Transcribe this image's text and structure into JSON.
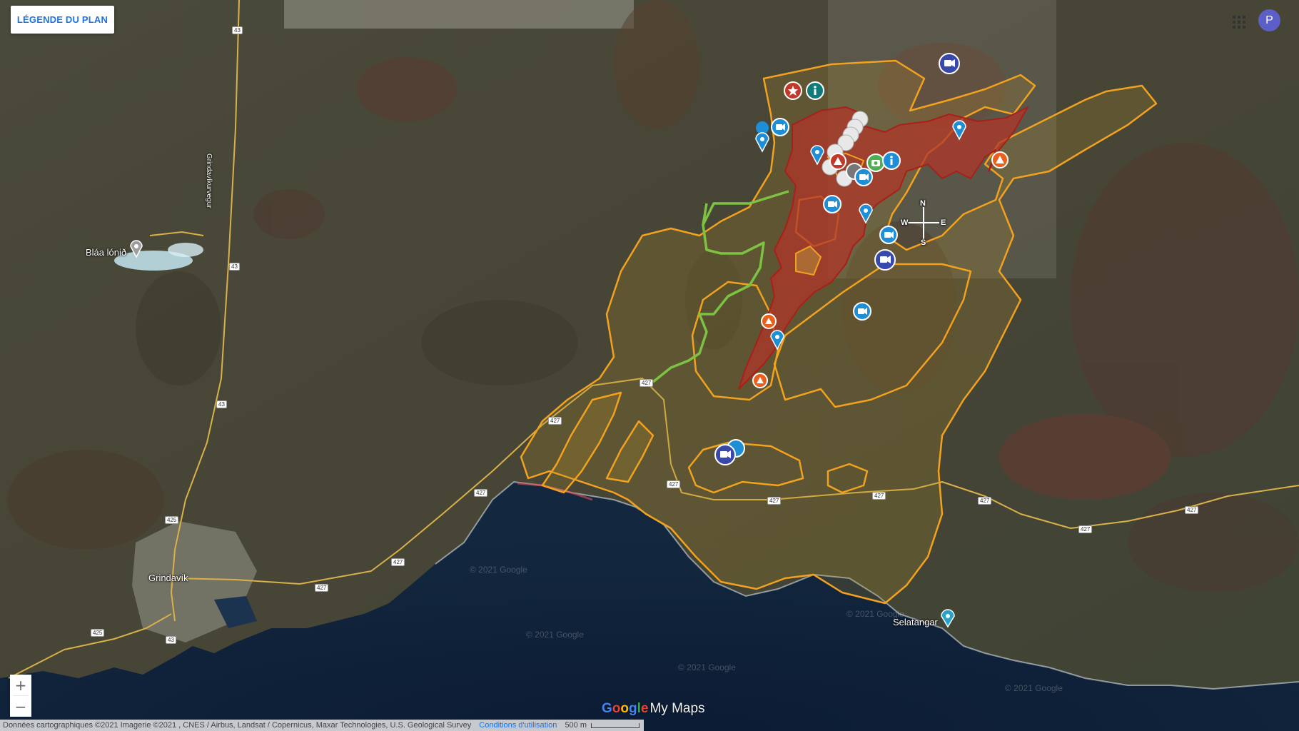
{
  "ui": {
    "legend_button": "LÉGENDE DU PLAN",
    "account_initial": "P",
    "zoom_in": "+",
    "zoom_out": "−"
  },
  "branding": {
    "google_letters": [
      "G",
      "o",
      "o",
      "g",
      "l",
      "e"
    ],
    "product": "My Maps"
  },
  "footer": {
    "attribution": "Données cartographiques ©2021 Imagerie ©2021 , CNES / Airbus, Landsat / Copernicus, Maxar Technologies, U.S. Geological Survey",
    "terms": "Conditions d'utilisation",
    "scale": "500 m"
  },
  "places": {
    "blue_lagoon": "Bláa lónið",
    "grindavik": "Grindavík",
    "selatangar": "Selatangar"
  },
  "road_labels": {
    "r43": "43",
    "r425": "425",
    "r427": "427",
    "grindavikurvegur": "Grindavíkurvegur"
  },
  "compass": {
    "n": "N",
    "s": "S",
    "e": "E",
    "w": "W"
  },
  "watermark": "© 2021 Google",
  "colors": {
    "lava_fill": "#b0362a",
    "lava_stroke": "#a8201a",
    "zone_stroke": "#f2a21e",
    "trail": "#7dc242",
    "pin_blue": "#1e8fd6",
    "camera_navy": "#3949ab",
    "info_teal": "#0f7a78",
    "hazard_orange": "#e8601c",
    "star_red": "#c0392b",
    "photo_green": "#4caf50"
  },
  "markers": [
    {
      "type": "camera-navy"
    },
    {
      "type": "star-red"
    },
    {
      "type": "info-teal"
    },
    {
      "type": "camera-blue"
    },
    {
      "type": "pin-blue"
    },
    {
      "type": "pin-blue"
    },
    {
      "type": "pin-blue"
    },
    {
      "type": "camera-blue"
    },
    {
      "type": "photo-green"
    },
    {
      "type": "info-blue"
    },
    {
      "type": "camera-blue"
    },
    {
      "type": "hazard-orange"
    },
    {
      "type": "pin-blue"
    },
    {
      "type": "camera-blue"
    },
    {
      "type": "camera-navy"
    },
    {
      "type": "camera-blue"
    },
    {
      "type": "hazard-orange"
    },
    {
      "type": "pin-blue"
    },
    {
      "type": "hazard-orange"
    },
    {
      "type": "camera-navy"
    },
    {
      "type": "viewpoint-white"
    },
    {
      "type": "viewpoint-white"
    },
    {
      "type": "viewpoint-white"
    },
    {
      "type": "viewpoint-white"
    },
    {
      "type": "viewpoint-white"
    },
    {
      "type": "viewpoint-white"
    },
    {
      "type": "viewpoint-white"
    },
    {
      "type": "camping-red"
    }
  ]
}
